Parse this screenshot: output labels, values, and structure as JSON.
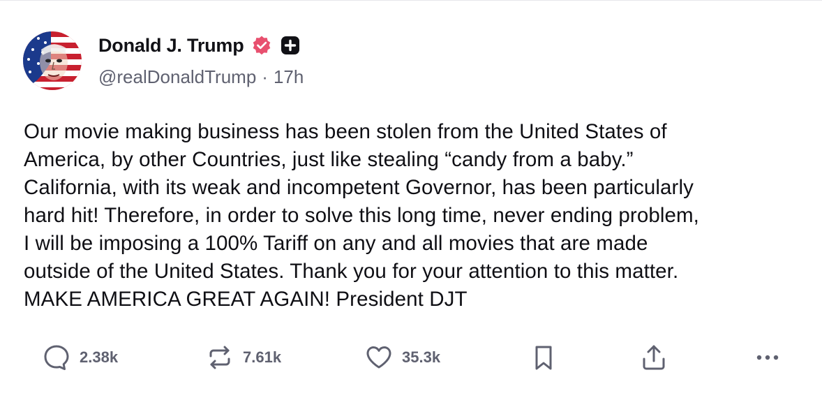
{
  "post": {
    "author": {
      "display_name": "Donald J. Trump",
      "handle": "@realDonaldTrump",
      "separator": "·",
      "time": "17h",
      "verified_icon": "verified-badge-icon",
      "verified_color": "#e8506f",
      "plus_icon": "plus-badge-icon"
    },
    "body_lines": [
      "Our movie making business has been stolen from the United States of",
      "America, by other Countries, just like stealing “candy from a baby.”",
      "California, with its weak and incompetent Governor, has been particularly",
      "hard hit! Therefore, in order to solve this long time, never ending problem,",
      "I will be imposing a 100% Tariff on any and all movies that are made",
      "outside of the United States. Thank you for your attention to this matter.",
      "MAKE AMERICA GREAT AGAIN! President DJT"
    ],
    "actions": {
      "reply": {
        "icon": "comment-icon",
        "count": "2.38k"
      },
      "repost": {
        "icon": "repost-icon",
        "count": "7.61k"
      },
      "like": {
        "icon": "heart-icon",
        "count": "35.3k"
      },
      "bookmark": {
        "icon": "bookmark-icon"
      },
      "share": {
        "icon": "share-icon"
      },
      "more": {
        "icon": "more-icon"
      }
    },
    "icon_color": "#5f6170"
  }
}
